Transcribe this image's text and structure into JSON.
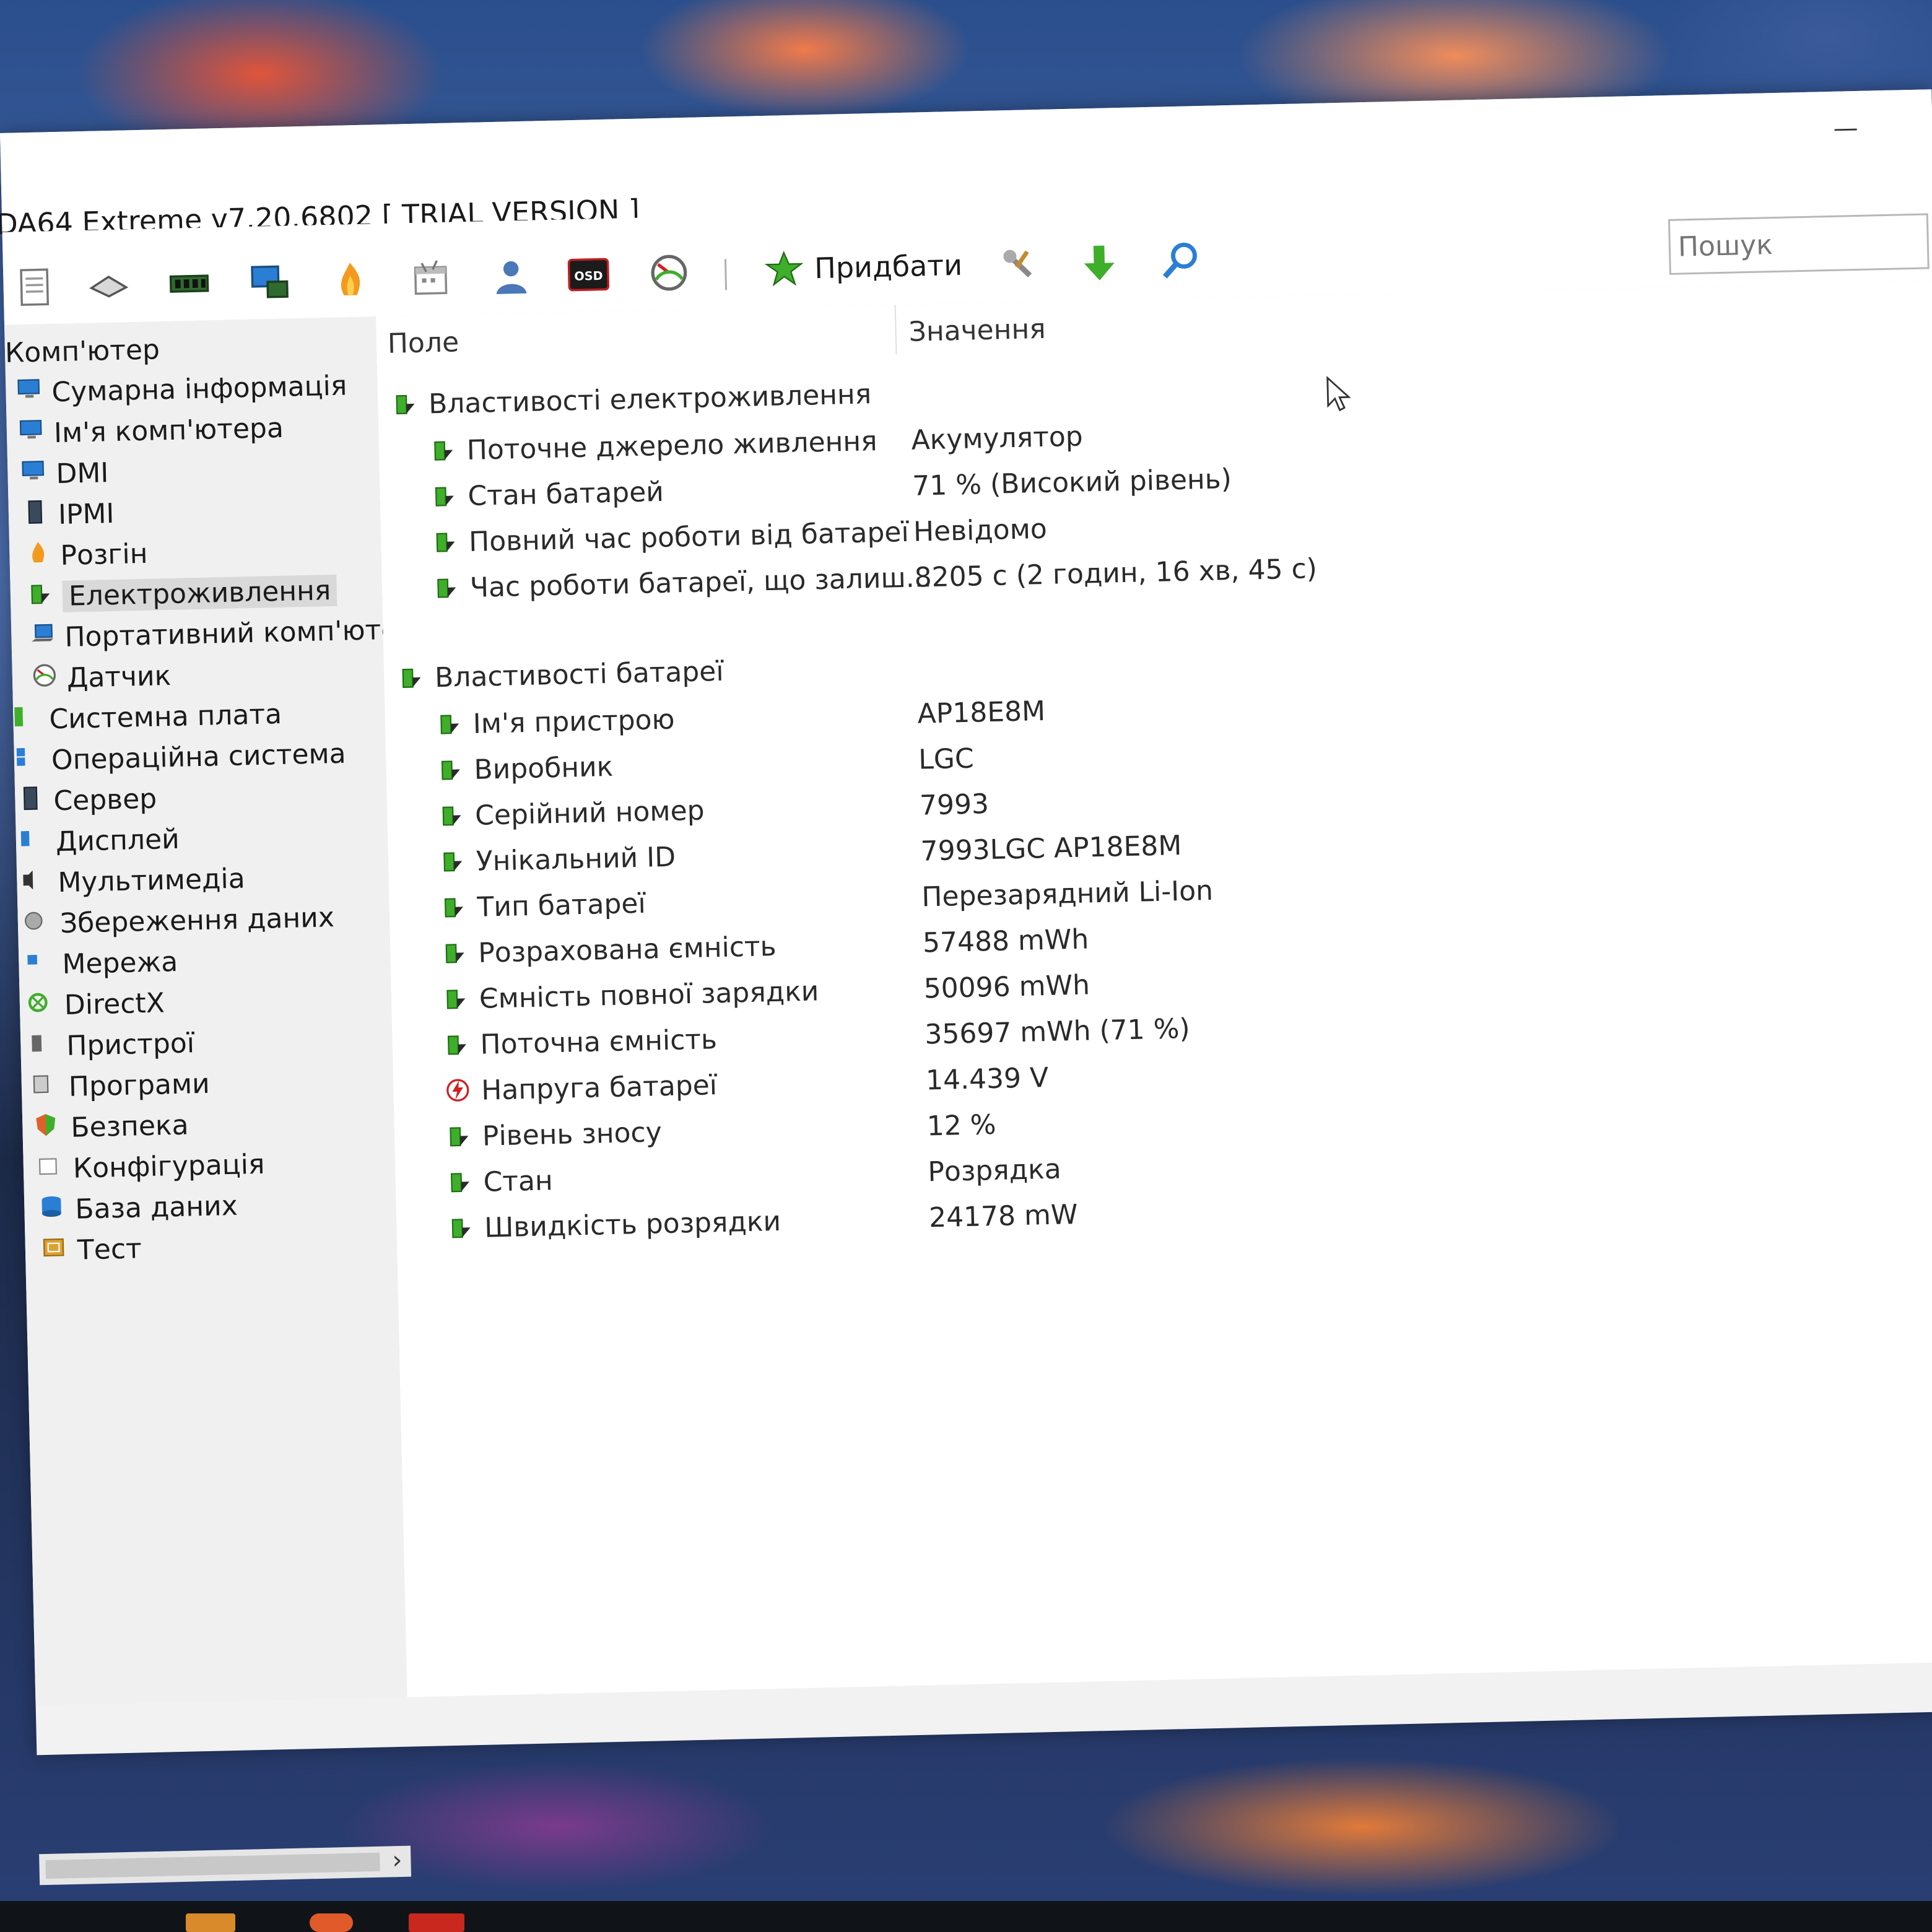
{
  "window": {
    "title": "DA64 Extreme v7.20.6802  [ TRIAL VERSION ]",
    "minimize_label": "—"
  },
  "toolbar": {
    "tools": [
      {
        "name": "report-icon"
      },
      {
        "name": "motherboard-icon"
      },
      {
        "name": "memory-icon"
      },
      {
        "name": "computer-icon"
      },
      {
        "name": "flame-icon"
      },
      {
        "name": "calendar-icon"
      },
      {
        "name": "user-icon"
      },
      {
        "name": "osd-icon",
        "text": "OSD"
      },
      {
        "name": "gauge-icon"
      }
    ],
    "buy_label": "Придбати",
    "search_placeholder": "Пошук"
  },
  "tree": {
    "root": "Комп'ютер",
    "items": [
      {
        "label": "Сумарна інформація",
        "icon": "monitor-icon"
      },
      {
        "label": "Ім'я комп'ютера",
        "icon": "monitor-icon"
      },
      {
        "label": "DMI",
        "icon": "monitor-icon"
      },
      {
        "label": "IPMI",
        "icon": "server-icon"
      },
      {
        "label": "Розгін",
        "icon": "flame-icon"
      },
      {
        "label": "Електроживлення",
        "icon": "power-icon",
        "selected": true
      },
      {
        "label": "Портативний комп'юте",
        "icon": "laptop-icon"
      },
      {
        "label": "Датчик",
        "icon": "gauge-icon"
      }
    ],
    "categories": [
      {
        "label": "Системна плата",
        "icon": "board-icon"
      },
      {
        "label": "Операційна система",
        "icon": "windows-icon"
      },
      {
        "label": "Сервер",
        "icon": "server-icon"
      },
      {
        "label": "Дисплей",
        "icon": "display-icon"
      },
      {
        "label": "Мультимедіа",
        "icon": "speaker-icon"
      },
      {
        "label": "Збереження даних",
        "icon": "disk-icon"
      },
      {
        "label": "Мережа",
        "icon": "network-icon"
      },
      {
        "label": "DirectX",
        "icon": "xbox-icon"
      },
      {
        "label": "Пристрої",
        "icon": "devices-icon"
      },
      {
        "label": "Програми",
        "icon": "programs-icon"
      },
      {
        "label": "Безпека",
        "icon": "shield-icon"
      },
      {
        "label": "Конфігурація",
        "icon": "config-icon"
      },
      {
        "label": "База даних",
        "icon": "database-icon"
      },
      {
        "label": "Тест",
        "icon": "test-icon"
      }
    ],
    "scroll_arrow": "›"
  },
  "columns": {
    "field": "Поле",
    "value": "Значення"
  },
  "sections": [
    {
      "title": "Властивості електроживлення",
      "rows": [
        {
          "field": "Поточне джерело живлення",
          "value": "Акумулятор"
        },
        {
          "field": "Стан батарей",
          "value": "71 % (Високий рівень)"
        },
        {
          "field": "Повний час роботи від батареї",
          "value": "Невідомо"
        },
        {
          "field": "Час роботи батареї, що залиш...",
          "value": "8205 с (2 годин, 16 хв, 45 с)"
        }
      ]
    },
    {
      "title": "Властивості батареї",
      "rows": [
        {
          "field": "Ім'я пристрою",
          "value": "AP18E8M"
        },
        {
          "field": "Виробник",
          "value": "LGC"
        },
        {
          "field": "Серійний номер",
          "value": "7993"
        },
        {
          "field": "Унікальний ID",
          "value": "7993LGC AP18E8M"
        },
        {
          "field": "Тип батареї",
          "value": "Перезарядний Li-Ion"
        },
        {
          "field": "Розрахована ємність",
          "value": "57488 mWh"
        },
        {
          "field": "Ємність повної зарядки",
          "value": "50096 mWh"
        },
        {
          "field": "Поточна ємність",
          "value": "35697 mWh  (71 %)"
        },
        {
          "field": "Напруга батареї",
          "value": "14.439 V",
          "icon": "voltage-icon"
        },
        {
          "field": "Рівень зносу",
          "value": "12 %"
        },
        {
          "field": "Стан",
          "value": "Розрядка"
        },
        {
          "field": "Швидкість розрядки",
          "value": "24178 mW"
        }
      ]
    }
  ],
  "colors": {
    "power_green": "#3fae2a",
    "selection": "#d9d9d9",
    "accent_blue": "#2a7fd4"
  }
}
